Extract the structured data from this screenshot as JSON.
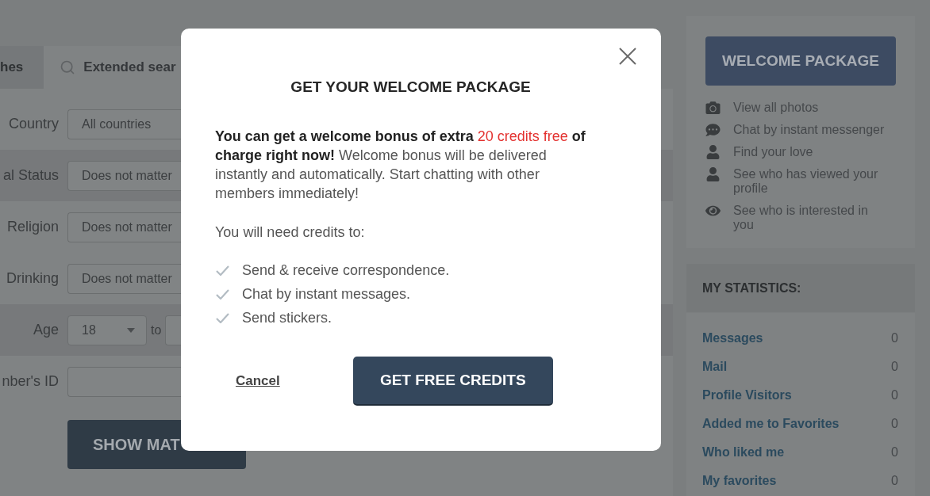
{
  "search_panel": {
    "tabs": [
      {
        "label": "hes",
        "kind": "plain",
        "selected": false
      },
      {
        "label": "Extended sear",
        "kind": "search",
        "selected": true
      }
    ],
    "fields": [
      {
        "kind": "select",
        "label": "Country",
        "value": "All countries"
      },
      {
        "kind": "select",
        "label": "al Status",
        "value": "Does not matter"
      },
      {
        "kind": "select",
        "label": "Religion",
        "value": "Does not matter"
      },
      {
        "kind": "select",
        "label": "Drinking",
        "value": "Does not matter"
      },
      {
        "kind": "range",
        "label": "Age",
        "value": "18",
        "joiner": "to"
      },
      {
        "kind": "input",
        "label": "nber's ID"
      }
    ],
    "submit_button": "SHOW MAT"
  },
  "sidebar": {
    "welcome_button": "WELCOME PACKAGE",
    "features": [
      {
        "kind": "photos",
        "text": "View all photos"
      },
      {
        "kind": "chat",
        "text": "Chat by instant messenger"
      },
      {
        "kind": "person",
        "text": "Find your love"
      },
      {
        "kind": "person",
        "text": "See who has viewed your profile"
      },
      {
        "kind": "eye",
        "text": "See who is interested in you"
      }
    ],
    "statistics": {
      "title": "MY STATISTICS:",
      "rows": [
        {
          "label": "Messages",
          "value": "0"
        },
        {
          "label": "Mail",
          "value": "0"
        },
        {
          "label": "Profile Visitors",
          "value": "0"
        },
        {
          "label": "Added me to Favorites",
          "value": "0"
        },
        {
          "label": "Who liked me",
          "value": "0"
        },
        {
          "label": "My favorites",
          "value": "0"
        }
      ]
    }
  },
  "modal": {
    "title": "GET YOUR WELCOME PACKAGE",
    "intro": [
      {
        "kind": "bold",
        "text": "You can get a welcome bonus of extra "
      },
      {
        "kind": "highlight",
        "text": "20 credits free"
      },
      {
        "kind": "bold",
        "text": " of charge right now!"
      },
      {
        "kind": "plain",
        "text": " Welcome bonus will be delivered instantly and automatically. Start chatting with other members immediately!"
      }
    ],
    "needs": "You will need credits to:",
    "benefits": [
      "Send & receive correspondence.",
      "Chat by instant messages.",
      "Send stickers."
    ],
    "cancel": "Cancel",
    "confirm": "GET FREE CREDITS"
  }
}
